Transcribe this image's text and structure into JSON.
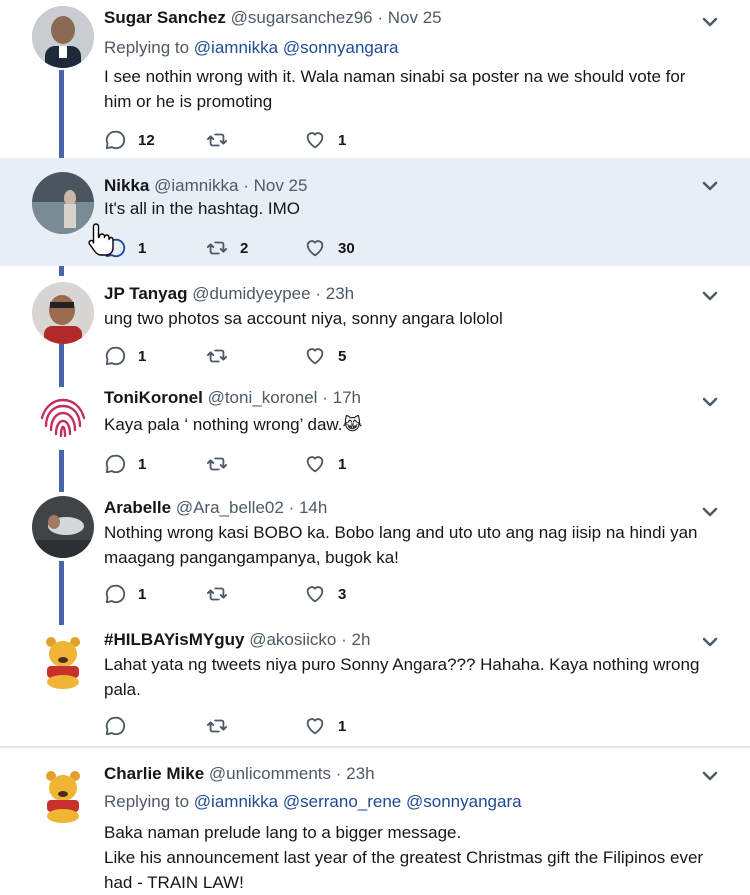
{
  "tweets": [
    {
      "name": "Sugar Sanchez",
      "handle": "@sugarsanchez96",
      "time": "Nov 25",
      "replying_prefix": "Replying to",
      "replying_to": [
        "@iamnikka",
        "@sonnyangara"
      ],
      "text": "I see nothin wrong with it. Wala naman sinabi sa poster na we should vote for him or he is promoting",
      "replies": "12",
      "retweets": "",
      "likes": "1"
    },
    {
      "name": "Nikka",
      "handle": "@iamnikka",
      "time": "Nov 25",
      "text": "It's all in the hashtag. IMO",
      "replies": "1",
      "retweets": "2",
      "likes": "30"
    },
    {
      "name": "JP Tanyag",
      "handle": "@dumidyeypee",
      "time": "23h",
      "text": "ung two photos sa account niya, sonny angara lololol",
      "replies": "1",
      "retweets": "",
      "likes": "5"
    },
    {
      "name": "ToniKoronel",
      "handle": "@toni_koronel",
      "time": "17h",
      "text": "Kaya pala ‘ nothing wrong’ daw.😹",
      "replies": "1",
      "retweets": "",
      "likes": "1"
    },
    {
      "name": "Arabelle",
      "handle": "@Ara_belle02",
      "time": "14h",
      "text": "Nothing wrong kasi BOBO ka. Bobo lang and uto uto ang nag iisip na hindi yan maagang pangangampanya, bugok ka!",
      "replies": "1",
      "retweets": "",
      "likes": "3"
    },
    {
      "name": "#HILBAYisMYguy",
      "handle": "@akosiicko",
      "time": "2h",
      "text": "Lahat yata ng tweets niya puro Sonny Angara??? Hahaha. Kaya nothing wrong pala.",
      "replies": "",
      "retweets": "",
      "likes": "1"
    },
    {
      "name": "Charlie Mike",
      "handle": "@unlicomments",
      "time": "23h",
      "replying_prefix": "Replying to",
      "replying_to": [
        "@iamnikka",
        "@serrano_rene",
        "@sonnyangara"
      ],
      "text": "Baka naman prelude lang to a bigger message.\nLike his announcement last year of the greatest Christmas gift the Filipinos ever had - TRAIN LAW!"
    }
  ],
  "icons": {
    "reply": "reply-icon",
    "retweet": "retweet-icon",
    "like": "heart-icon",
    "menu": "chevron-down-icon"
  },
  "colors": {
    "highlight_bg": "#e8eef5",
    "thread_line": "#4a64a8",
    "mention": "#1f4b96"
  }
}
